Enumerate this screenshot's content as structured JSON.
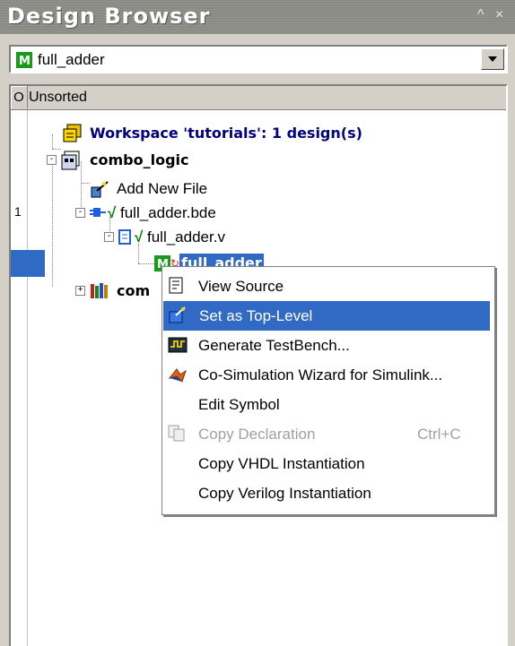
{
  "window": {
    "title": "Design Browser",
    "pin_icon": "pin-icon",
    "close_icon": "close-icon"
  },
  "combo": {
    "value": "full_adder",
    "icon": "verilog-module-icon"
  },
  "header": {
    "col_o": "O",
    "col_name": "Unsorted"
  },
  "tree": {
    "workspace": "Workspace 'tutorials': 1 design(s)",
    "design": "combo_logic",
    "add_new_file": "Add New File",
    "bde_file": "full_adder.bde",
    "bde_num": "1",
    "v_file": "full_adder.v",
    "module": "full_adder",
    "lib_partial": "com"
  },
  "menu": {
    "items": [
      {
        "label": "View Source",
        "icon": "view-source-icon"
      },
      {
        "label": "Set as Top-Level",
        "icon": "set-top-level-icon"
      },
      {
        "label": "Generate TestBench...",
        "icon": "testbench-icon"
      },
      {
        "label": "Co-Simulation Wizard for Simulink...",
        "icon": "matlab-icon"
      },
      {
        "label": "Edit Symbol"
      },
      {
        "label": "Copy Declaration",
        "shortcut": "Ctrl+C",
        "icon": "copy-icon"
      },
      {
        "label": "Copy VHDL Instantiation"
      },
      {
        "label": "Copy Verilog Instantiation"
      }
    ]
  },
  "colors": {
    "selection": "#316ac5",
    "title_bg": "#8a8a84",
    "face": "#d4d0c8"
  }
}
